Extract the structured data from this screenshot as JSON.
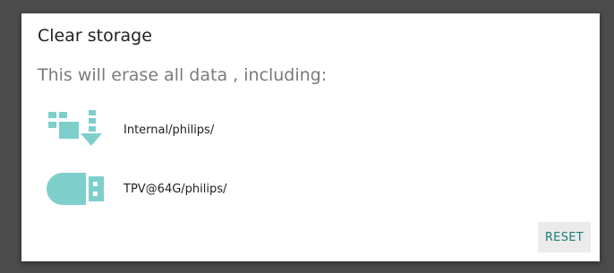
{
  "dialog": {
    "title": "Clear storage",
    "message": "This will erase all data , including:",
    "items": [
      {
        "icon": "internal-storage-icon",
        "label": "Internal/philips/"
      },
      {
        "icon": "usb-drive-icon",
        "label": "TPV@64G/philips/"
      }
    ],
    "reset_label": "RESET"
  },
  "colors": {
    "accent": "#1f7e73",
    "icon": "#7ecfcc",
    "scrim": "#4b4b4b",
    "dialog_bg": "#ffffff"
  }
}
